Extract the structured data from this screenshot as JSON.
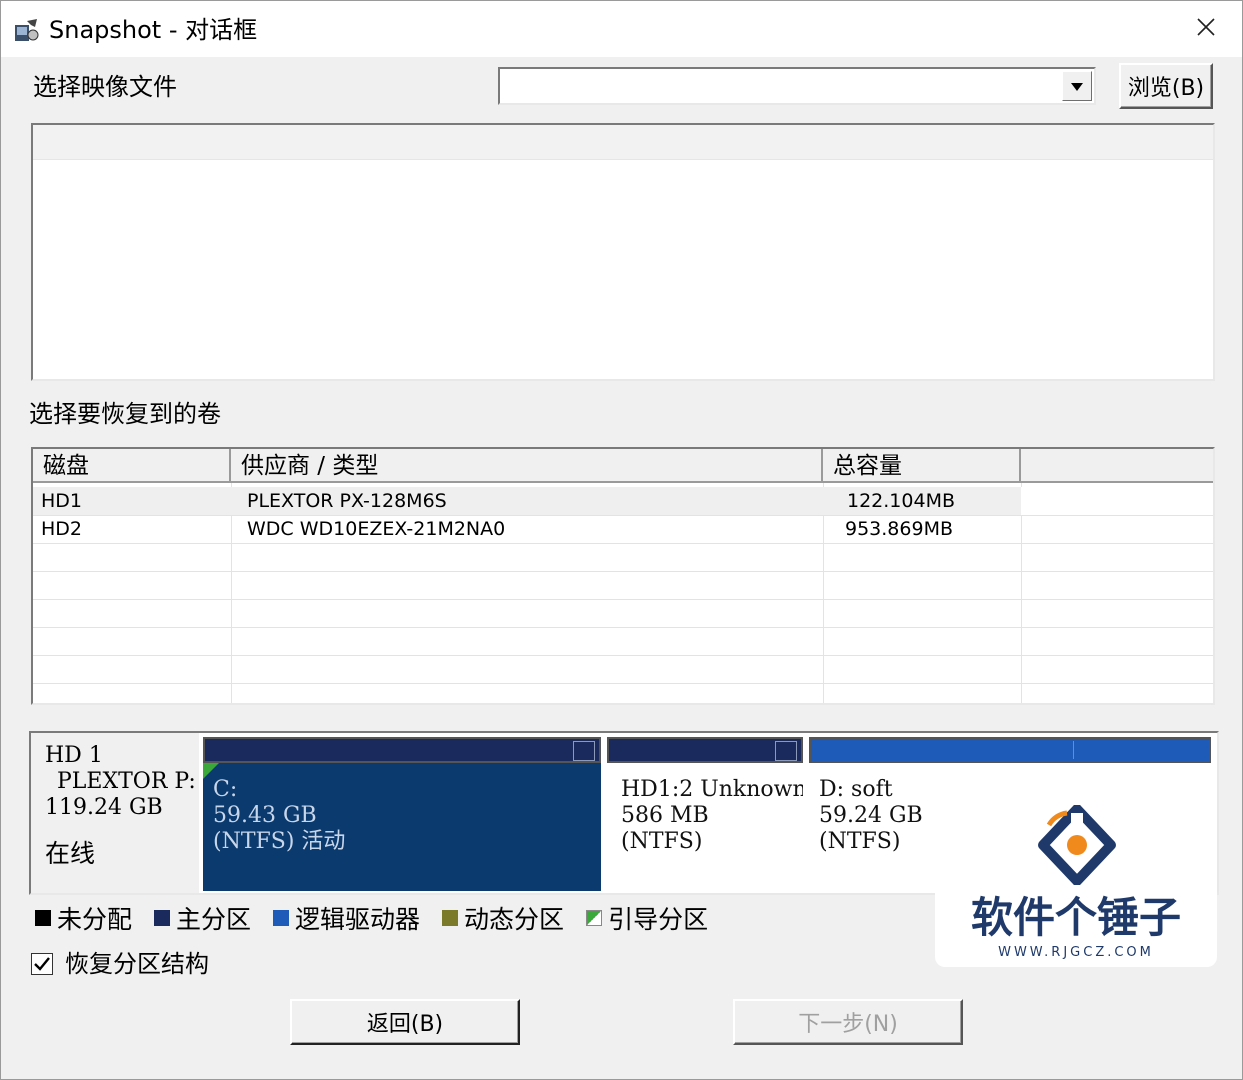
{
  "window": {
    "title": "Snapshot - 对话框"
  },
  "image_file": {
    "label": "选择映像文件",
    "value": "",
    "browse_label": "浏览(B)"
  },
  "volumes": {
    "label": "选择要恢复到的卷",
    "columns": [
      "磁盘",
      "供应商 / 类型",
      "总容量"
    ],
    "rows": [
      {
        "disk": "HD1",
        "vendor": "PLEXTOR PX-128M6S",
        "capacity": "122.104MB"
      },
      {
        "disk": "HD2",
        "vendor": "WDC WD10EZEX-21M2NA0",
        "capacity": "953.869MB"
      }
    ]
  },
  "disk_map": {
    "disk_name": "HD 1",
    "disk_model": "PLEXTOR P:",
    "disk_size": "119.24 GB",
    "disk_status": "在线",
    "partitions": [
      {
        "name": "C:",
        "size": "59.43 GB",
        "fs": "(NTFS) 活动",
        "color": "#0b3a6e"
      },
      {
        "name": "HD1:2 Unknown",
        "size": "586 MB",
        "fs": "(NTFS)",
        "color": "#ffffff"
      },
      {
        "name": "D: soft",
        "size": "59.24 GB",
        "fs": "(NTFS)",
        "color": "#ffffff"
      }
    ]
  },
  "legend": [
    {
      "label": "未分配",
      "color": "#000000"
    },
    {
      "label": "主分区",
      "color": "#1a2a5c"
    },
    {
      "label": "逻辑驱动器",
      "color": "#1e5ab8"
    },
    {
      "label": "动态分区",
      "color": "#7a7a2a"
    },
    {
      "label": "引导分区",
      "color": "#3aa83a"
    }
  ],
  "restore_structure": {
    "label": "恢复分区结构",
    "checked": true
  },
  "buttons": {
    "back": "返回(B)",
    "next": "下一步(N)"
  },
  "watermark": {
    "brand": "软件个锤子",
    "url": "WWW.RJGCZ.COM"
  }
}
